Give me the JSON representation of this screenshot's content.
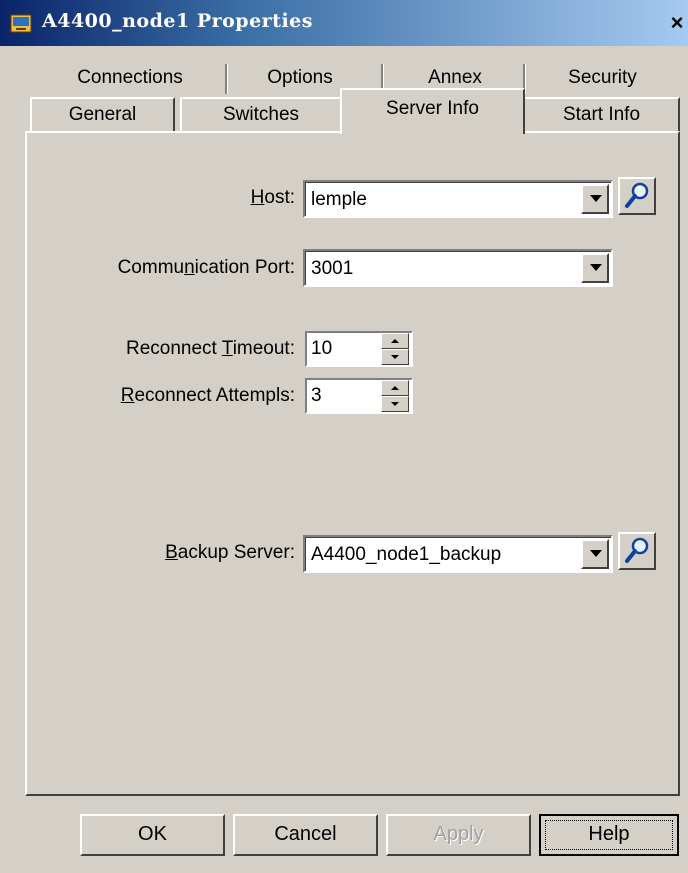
{
  "window": {
    "title": "A4400_node1 Properties",
    "close_label": "×"
  },
  "tabs_row1": [
    {
      "label": "Connections"
    },
    {
      "label": "Options"
    },
    {
      "label": "Annex"
    },
    {
      "label": "Security"
    }
  ],
  "tabs_row2": [
    {
      "label": "General"
    },
    {
      "label": "Switches"
    },
    {
      "label": "Server Info",
      "selected": true
    },
    {
      "label": "Start Info"
    }
  ],
  "form": {
    "host": {
      "label_pre": "",
      "label_u": "H",
      "label_post": "ost:",
      "value": "lemple"
    },
    "port": {
      "label_pre": "Commu",
      "label_u": "n",
      "label_post": "ication Port:",
      "value": "3001"
    },
    "timeout": {
      "label_pre": "Reconnect ",
      "label_u": "T",
      "label_post": "imeout:",
      "value": "10"
    },
    "attempts": {
      "label_pre": "",
      "label_u": "R",
      "label_post": "econnect Attempls:",
      "value": "3"
    },
    "backup": {
      "label_pre": "",
      "label_u": "B",
      "label_post": "ackup Server:",
      "value": "A4400_node1_backup"
    }
  },
  "buttons": {
    "ok": "OK",
    "cancel": "Cancel",
    "apply": "Apply",
    "help": "Help"
  },
  "icons": {
    "window_icon": "window-icon",
    "browse": "magnifier-icon",
    "dropdown": "chevron-down-icon"
  },
  "colors": {
    "title_gradient_start": "#0a246a",
    "title_gradient_end": "#a6caf0",
    "face": "#d4d0c8"
  }
}
